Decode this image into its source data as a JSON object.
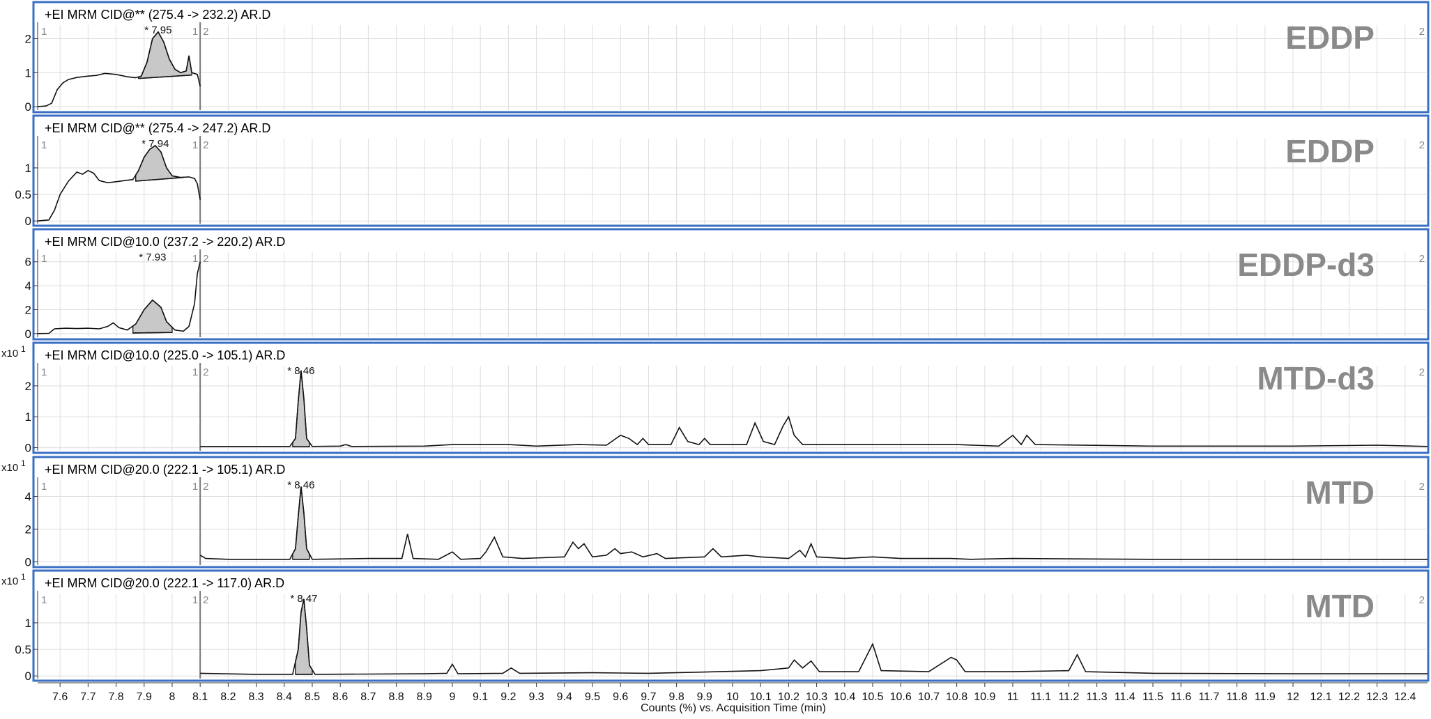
{
  "chart_data": {
    "type": "line",
    "x_axis": {
      "label": "Counts (%) vs. Acquisition Time (min)",
      "range": [
        7.52,
        12.48
      ],
      "ticks": [
        7.6,
        7.7,
        7.8,
        7.9,
        8,
        8.1,
        8.2,
        8.3,
        8.4,
        8.5,
        8.6,
        8.7,
        8.8,
        8.9,
        9,
        9.1,
        9.2,
        9.3,
        9.4,
        9.5,
        9.6,
        9.7,
        9.8,
        9.9,
        10,
        10.1,
        10.2,
        10.3,
        10.4,
        10.5,
        10.6,
        10.7,
        10.8,
        10.9,
        11,
        11.1,
        11.2,
        11.3,
        11.4,
        11.5,
        11.6,
        11.7,
        11.8,
        11.9,
        12,
        12.1,
        12.2,
        12.3,
        12.4
      ],
      "tick_labels": [
        "7.6",
        "7.7",
        "7.8",
        "7.9",
        "8",
        "8.1",
        "8.2",
        "8.3",
        "8.4",
        "8.5",
        "8.6",
        "8.7",
        "8.8",
        "8.9",
        "9",
        "9.1",
        "9.2",
        "9.3",
        "9.4",
        "9.5",
        "9.6",
        "9.7",
        "9.8",
        "9.9",
        "10",
        "10.1",
        "10.2",
        "10.3",
        "10.4",
        "10.5",
        "10.6",
        "10.7",
        "10.8",
        "10.9",
        "11",
        "11.1",
        "11.2",
        "11.3",
        "11.4",
        "11.5",
        "11.6",
        "11.7",
        "11.8",
        "11.9",
        "12",
        "12.1",
        "12.2",
        "12.3",
        "12.4"
      ]
    },
    "segment_boundary": 8.1,
    "segment_labels": [
      "1",
      "1",
      "2",
      "2"
    ],
    "grid": true,
    "colors": {
      "frame": "#3a6fc4",
      "trace": "#111111",
      "peak_fill": "#c8c8c8",
      "grid": "#dddddd",
      "compound_label": "#8a8a8a"
    },
    "panels": [
      {
        "title": "+EI MRM CID@** (275.4 -> 232.2) AR.D",
        "compound": "EDDP",
        "multiplier": "",
        "multiplier_exp": "",
        "y_ticks": [
          "0",
          "1",
          "2"
        ],
        "y_tick_values": [
          0,
          1,
          2
        ],
        "ylim": [
          -0.1,
          2.4
        ],
        "trace_range": [
          7.52,
          8.1
        ],
        "peak": {
          "label": "* 7.95",
          "rt": 7.95,
          "start": 7.88,
          "end": 8.07,
          "base_start": 0.83,
          "base_end": 0.93
        },
        "points": [
          [
            7.52,
            0
          ],
          [
            7.55,
            0.02
          ],
          [
            7.57,
            0.1
          ],
          [
            7.59,
            0.5
          ],
          [
            7.61,
            0.7
          ],
          [
            7.63,
            0.8
          ],
          [
            7.66,
            0.86
          ],
          [
            7.7,
            0.9
          ],
          [
            7.73,
            0.92
          ],
          [
            7.76,
            0.98
          ],
          [
            7.8,
            0.95
          ],
          [
            7.84,
            0.88
          ],
          [
            7.87,
            0.85
          ],
          [
            7.89,
            0.9
          ],
          [
            7.91,
            1.3
          ],
          [
            7.93,
            2.0
          ],
          [
            7.95,
            2.2
          ],
          [
            7.97,
            1.9
          ],
          [
            7.99,
            1.4
          ],
          [
            8.01,
            1.1
          ],
          [
            8.03,
            1.0
          ],
          [
            8.05,
            1.05
          ],
          [
            8.06,
            1.5
          ],
          [
            8.07,
            1.0
          ],
          [
            8.09,
            0.95
          ],
          [
            8.1,
            0.6
          ]
        ]
      },
      {
        "title": "+EI MRM CID@** (275.4 -> 247.2) AR.D",
        "compound": "EDDP",
        "multiplier": "",
        "multiplier_exp": "",
        "y_ticks": [
          "0",
          "0.5",
          "1"
        ],
        "y_tick_values": [
          0,
          0.5,
          1
        ],
        "ylim": [
          -0.05,
          1.55
        ],
        "trace_range": [
          7.52,
          8.1
        ],
        "peak": {
          "label": "* 7.94",
          "rt": 7.94,
          "start": 7.87,
          "end": 8.04,
          "base_start": 0.75,
          "base_end": 0.82
        },
        "points": [
          [
            7.52,
            0
          ],
          [
            7.56,
            0.02
          ],
          [
            7.58,
            0.2
          ],
          [
            7.6,
            0.5
          ],
          [
            7.63,
            0.75
          ],
          [
            7.66,
            0.92
          ],
          [
            7.68,
            0.88
          ],
          [
            7.7,
            0.95
          ],
          [
            7.72,
            0.9
          ],
          [
            7.74,
            0.76
          ],
          [
            7.77,
            0.72
          ],
          [
            7.8,
            0.74
          ],
          [
            7.83,
            0.76
          ],
          [
            7.86,
            0.78
          ],
          [
            7.88,
            0.95
          ],
          [
            7.9,
            1.2
          ],
          [
            7.92,
            1.35
          ],
          [
            7.94,
            1.42
          ],
          [
            7.96,
            1.3
          ],
          [
            7.98,
            1.0
          ],
          [
            8.0,
            0.85
          ],
          [
            8.03,
            0.82
          ],
          [
            8.06,
            0.83
          ],
          [
            8.08,
            0.8
          ],
          [
            8.09,
            0.7
          ],
          [
            8.1,
            0.4
          ]
        ]
      },
      {
        "title": "+EI MRM CID@10.0 (237.2 -> 220.2) AR.D",
        "compound": "EDDP-d3",
        "multiplier": "",
        "multiplier_exp": "",
        "y_ticks": [
          "0",
          "2",
          "4",
          "6"
        ],
        "y_tick_values": [
          0,
          2,
          4,
          6
        ],
        "ylim": [
          -0.3,
          6.8
        ],
        "trace_range": [
          7.52,
          8.1
        ],
        "peak": {
          "label": "* 7.93",
          "rt": 7.93,
          "start": 7.86,
          "end": 8.0,
          "base_start": 0.05,
          "base_end": 0.1
        },
        "points": [
          [
            7.52,
            0
          ],
          [
            7.56,
            0.02
          ],
          [
            7.58,
            0.4
          ],
          [
            7.62,
            0.45
          ],
          [
            7.66,
            0.42
          ],
          [
            7.7,
            0.45
          ],
          [
            7.74,
            0.4
          ],
          [
            7.77,
            0.6
          ],
          [
            7.79,
            0.9
          ],
          [
            7.81,
            0.5
          ],
          [
            7.84,
            0.3
          ],
          [
            7.87,
            0.8
          ],
          [
            7.9,
            2.0
          ],
          [
            7.93,
            2.8
          ],
          [
            7.96,
            2.2
          ],
          [
            7.98,
            1.0
          ],
          [
            8.01,
            0.3
          ],
          [
            8.04,
            0.2
          ],
          [
            8.06,
            0.6
          ],
          [
            8.08,
            2.5
          ],
          [
            8.09,
            5.0
          ],
          [
            8.1,
            6.0
          ]
        ]
      },
      {
        "title": "+EI MRM CID@10.0 (225.0 -> 105.1) AR.D",
        "compound": "MTD-d3",
        "multiplier": "x10",
        "multiplier_exp": "1",
        "y_ticks": [
          "0",
          "1",
          "2"
        ],
        "y_tick_values": [
          0,
          1,
          2
        ],
        "ylim": [
          -0.1,
          2.65
        ],
        "trace_range": [
          8.1,
          12.48
        ],
        "peak": {
          "label": "* 8.46",
          "rt": 8.46,
          "start": 8.43,
          "end": 8.49,
          "base_start": 0.03,
          "base_end": 0.03
        },
        "points": [
          [
            8.1,
            0.04
          ],
          [
            8.3,
            0.04
          ],
          [
            8.42,
            0.04
          ],
          [
            8.44,
            0.3
          ],
          [
            8.45,
            1.5
          ],
          [
            8.46,
            2.5
          ],
          [
            8.47,
            1.6
          ],
          [
            8.48,
            0.3
          ],
          [
            8.5,
            0.04
          ],
          [
            8.6,
            0.05
          ],
          [
            8.62,
            0.1
          ],
          [
            8.64,
            0.04
          ],
          [
            8.9,
            0.05
          ],
          [
            9.0,
            0.1
          ],
          [
            9.1,
            0.1
          ],
          [
            9.2,
            0.1
          ],
          [
            9.3,
            0.05
          ],
          [
            9.45,
            0.1
          ],
          [
            9.55,
            0.08
          ],
          [
            9.6,
            0.4
          ],
          [
            9.63,
            0.3
          ],
          [
            9.66,
            0.1
          ],
          [
            9.68,
            0.3
          ],
          [
            9.7,
            0.1
          ],
          [
            9.78,
            0.1
          ],
          [
            9.81,
            0.65
          ],
          [
            9.84,
            0.2
          ],
          [
            9.88,
            0.1
          ],
          [
            9.9,
            0.3
          ],
          [
            9.92,
            0.1
          ],
          [
            10.05,
            0.1
          ],
          [
            10.08,
            0.8
          ],
          [
            10.11,
            0.2
          ],
          [
            10.15,
            0.1
          ],
          [
            10.18,
            0.7
          ],
          [
            10.2,
            1.0
          ],
          [
            10.22,
            0.4
          ],
          [
            10.25,
            0.1
          ],
          [
            10.5,
            0.1
          ],
          [
            10.8,
            0.1
          ],
          [
            10.95,
            0.05
          ],
          [
            11.0,
            0.4
          ],
          [
            11.03,
            0.1
          ],
          [
            11.05,
            0.4
          ],
          [
            11.08,
            0.1
          ],
          [
            11.5,
            0.05
          ],
          [
            12.0,
            0.05
          ],
          [
            12.3,
            0.08
          ],
          [
            12.48,
            0.04
          ]
        ]
      },
      {
        "title": "+EI MRM CID@20.0 (222.1 -> 105.1) AR.D",
        "compound": "MTD",
        "multiplier": "x10",
        "multiplier_exp": "1",
        "y_ticks": [
          "0",
          "2",
          "4"
        ],
        "y_tick_values": [
          0,
          2,
          4
        ],
        "ylim": [
          -0.2,
          5.0
        ],
        "trace_range": [
          8.1,
          12.48
        ],
        "peak": {
          "label": "* 8.46",
          "rt": 8.46,
          "start": 8.43,
          "end": 8.49,
          "base_start": 0.15,
          "base_end": 0.15
        },
        "points": [
          [
            8.1,
            0.4
          ],
          [
            8.12,
            0.2
          ],
          [
            8.2,
            0.15
          ],
          [
            8.42,
            0.15
          ],
          [
            8.44,
            0.8
          ],
          [
            8.45,
            2.8
          ],
          [
            8.46,
            4.6
          ],
          [
            8.47,
            3.0
          ],
          [
            8.48,
            0.8
          ],
          [
            8.5,
            0.15
          ],
          [
            8.7,
            0.2
          ],
          [
            8.82,
            0.2
          ],
          [
            8.84,
            1.7
          ],
          [
            8.86,
            0.2
          ],
          [
            8.95,
            0.15
          ],
          [
            9.0,
            0.6
          ],
          [
            9.03,
            0.15
          ],
          [
            9.1,
            0.2
          ],
          [
            9.12,
            0.6
          ],
          [
            9.15,
            1.5
          ],
          [
            9.18,
            0.3
          ],
          [
            9.25,
            0.2
          ],
          [
            9.4,
            0.3
          ],
          [
            9.43,
            1.2
          ],
          [
            9.45,
            0.8
          ],
          [
            9.47,
            1.1
          ],
          [
            9.5,
            0.3
          ],
          [
            9.55,
            0.4
          ],
          [
            9.58,
            0.8
          ],
          [
            9.6,
            0.5
          ],
          [
            9.64,
            0.6
          ],
          [
            9.68,
            0.3
          ],
          [
            9.73,
            0.5
          ],
          [
            9.76,
            0.2
          ],
          [
            9.9,
            0.3
          ],
          [
            9.93,
            0.8
          ],
          [
            9.96,
            0.3
          ],
          [
            10.05,
            0.4
          ],
          [
            10.1,
            0.3
          ],
          [
            10.2,
            0.2
          ],
          [
            10.24,
            0.7
          ],
          [
            10.26,
            0.3
          ],
          [
            10.28,
            1.1
          ],
          [
            10.3,
            0.3
          ],
          [
            10.4,
            0.2
          ],
          [
            10.5,
            0.3
          ],
          [
            10.6,
            0.2
          ],
          [
            10.78,
            0.2
          ],
          [
            10.85,
            0.15
          ],
          [
            11.0,
            0.2
          ],
          [
            11.5,
            0.15
          ],
          [
            12.0,
            0.15
          ],
          [
            12.48,
            0.15
          ]
        ]
      },
      {
        "title": "+EI MRM CID@20.0 (222.1 -> 117.0) AR.D",
        "compound": "MTD",
        "multiplier": "x10",
        "multiplier_exp": "1",
        "y_ticks": [
          "0",
          "0.5",
          "1"
        ],
        "y_tick_values": [
          0,
          0.5,
          1
        ],
        "ylim": [
          -0.05,
          1.55
        ],
        "trace_range": [
          8.1,
          12.48
        ],
        "peak": {
          "label": "* 8.47",
          "rt": 8.47,
          "start": 8.44,
          "end": 8.5,
          "base_start": 0.03,
          "base_end": 0.03
        },
        "points": [
          [
            8.1,
            0.05
          ],
          [
            8.3,
            0.03
          ],
          [
            8.43,
            0.03
          ],
          [
            8.45,
            0.5
          ],
          [
            8.46,
            1.2
          ],
          [
            8.47,
            1.45
          ],
          [
            8.48,
            0.9
          ],
          [
            8.49,
            0.2
          ],
          [
            8.51,
            0.03
          ],
          [
            8.9,
            0.04
          ],
          [
            8.98,
            0.05
          ],
          [
            9.0,
            0.22
          ],
          [
            9.02,
            0.04
          ],
          [
            9.18,
            0.05
          ],
          [
            9.21,
            0.15
          ],
          [
            9.24,
            0.05
          ],
          [
            9.5,
            0.06
          ],
          [
            9.7,
            0.05
          ],
          [
            9.95,
            0.08
          ],
          [
            10.1,
            0.1
          ],
          [
            10.2,
            0.15
          ],
          [
            10.22,
            0.3
          ],
          [
            10.25,
            0.15
          ],
          [
            10.28,
            0.28
          ],
          [
            10.31,
            0.08
          ],
          [
            10.45,
            0.08
          ],
          [
            10.5,
            0.6
          ],
          [
            10.53,
            0.1
          ],
          [
            10.7,
            0.08
          ],
          [
            10.78,
            0.35
          ],
          [
            10.8,
            0.3
          ],
          [
            10.83,
            0.08
          ],
          [
            11.0,
            0.08
          ],
          [
            11.2,
            0.1
          ],
          [
            11.23,
            0.4
          ],
          [
            11.26,
            0.08
          ],
          [
            11.5,
            0.05
          ],
          [
            12.0,
            0.04
          ],
          [
            12.48,
            0.04
          ]
        ]
      }
    ]
  }
}
